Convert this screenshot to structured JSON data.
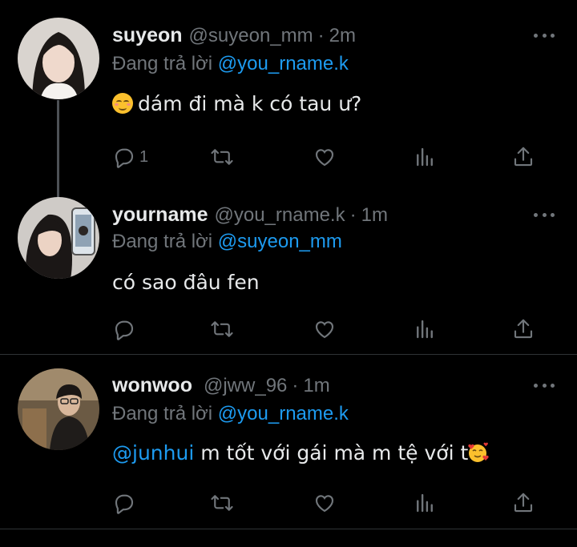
{
  "tweets": [
    {
      "name": "suyeon",
      "handle": "@suyeon_mm",
      "dot": "·",
      "time": "2m",
      "replying_prefix": "Đang trả lời ",
      "replying_to": "@you_rname.k",
      "text": "dám đi mà k có tau ư?",
      "leading_emoji": "smiling-face-icon",
      "reply_count": "1"
    },
    {
      "name": "yourname",
      "handle": "@you_rname.k",
      "dot": "·",
      "time": "1m",
      "replying_prefix": "Đang trả lời ",
      "replying_to": "@suyeon_mm",
      "text": "có sao đâu fen",
      "reply_count": ""
    },
    {
      "name": "wonwoo",
      "handle": "@jww_96",
      "dot": "·",
      "time": "1m",
      "replying_prefix": "Đang trả lời ",
      "replying_to": "@you_rname.k",
      "text_mention": "@junhui",
      "text": " m tốt với gái mà m tệ với t",
      "trailing_emoji": "smiling-face-with-hearts-icon",
      "reply_count": ""
    }
  ],
  "colors": {
    "background": "#000000",
    "text": "#e7e9ea",
    "muted": "#71767b",
    "accent": "#1d9bf0",
    "separator": "#2f3336"
  }
}
